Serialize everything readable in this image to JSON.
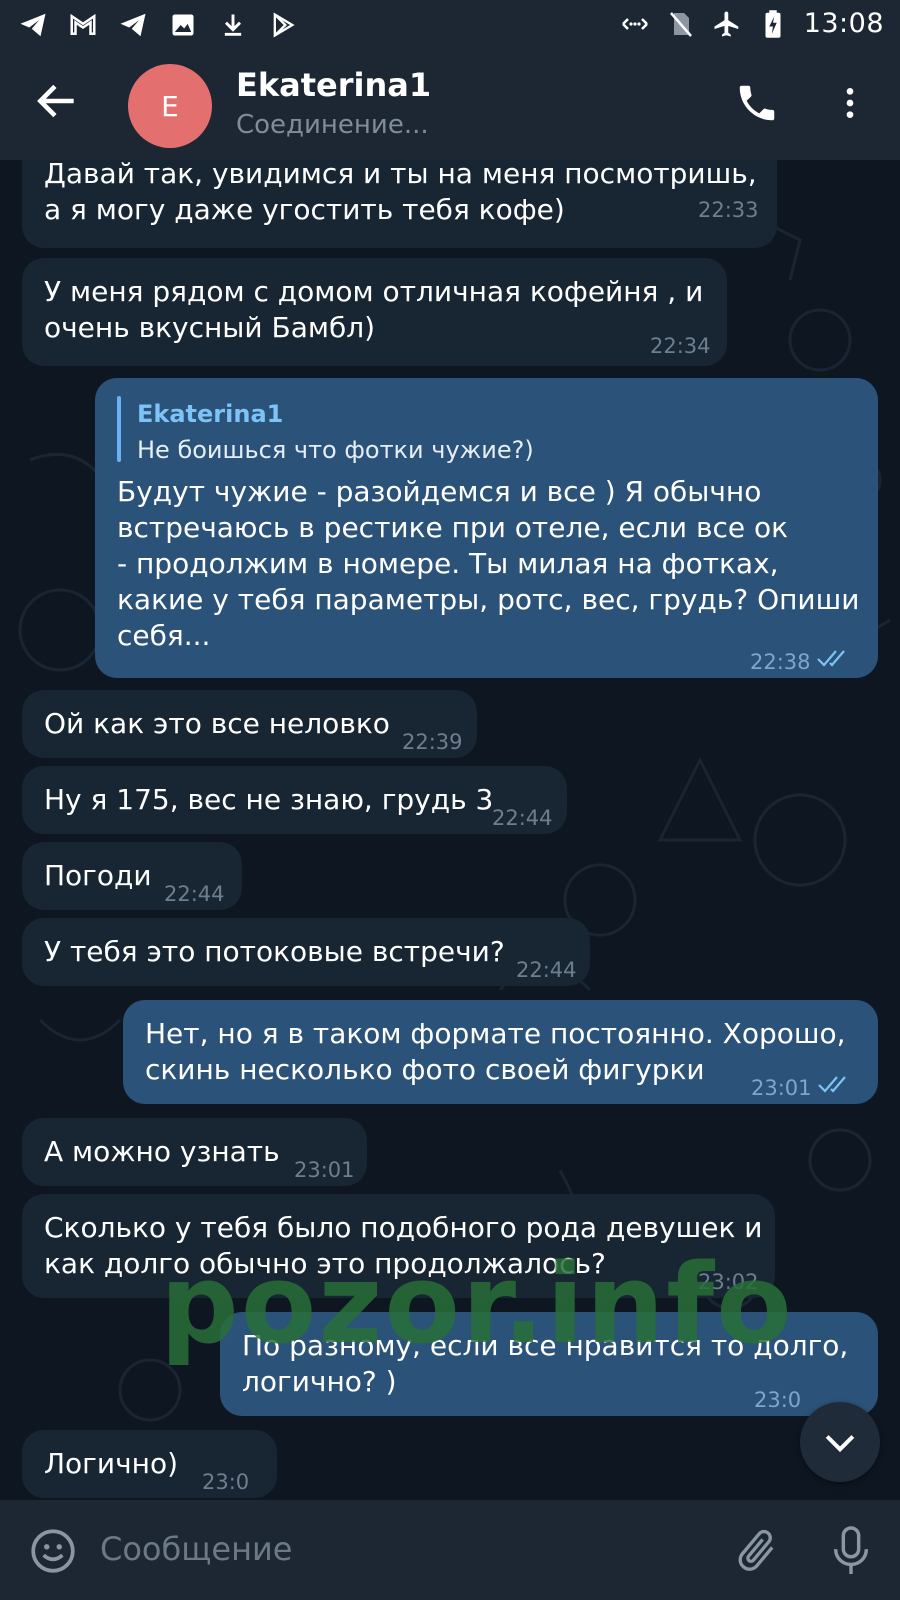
{
  "status_bar": {
    "time": "13:08",
    "left_icons": [
      "telegram-icon",
      "gmail-icon",
      "telegram-icon",
      "image-icon",
      "download-icon",
      "play-store-icon"
    ],
    "right_icons": [
      "data-saver-icon",
      "no-sim-icon",
      "airplane-icon",
      "battery-charging-icon"
    ]
  },
  "header": {
    "avatar_letter": "E",
    "name": "Ekaterina1",
    "status": "Соединение...",
    "avatar_color": "#e46f6f"
  },
  "messages": [
    {
      "dir": "in",
      "text": "Давай так, увидимся и ты на меня посмотришь,\nа я могу даже угостить тебя кофе)",
      "time": "22:33"
    },
    {
      "dir": "in",
      "text": "У меня рядом с домом отличная кофейня , и\nочень вкусный Бамбл)",
      "time": "22:34"
    },
    {
      "dir": "out",
      "reply_name": "Ekaterina1",
      "reply_text": "Не боишься что фотки чужие?)",
      "text": "Будут чужие - разойдемся и все ) Я обычно\nвстречаюсь в рестике при отеле, если все ок\n- продолжим в номере. Ты милая на фотках,\nкакие у тебя параметры, ротс, вес, грудь? Опиши\nсебя...",
      "time": "22:38"
    },
    {
      "dir": "in",
      "text": "Ой как это все неловко",
      "time": "22:39"
    },
    {
      "dir": "in",
      "text": "Ну я 175, вес не знаю, грудь 3",
      "time": "22:44"
    },
    {
      "dir": "in",
      "text": "Погоди",
      "time": "22:44"
    },
    {
      "dir": "in",
      "text": "У тебя это потоковые встречи?",
      "time": "22:44"
    },
    {
      "dir": "out",
      "text": "Нет, но я в таком формате постоянно. Хорошо,\nскинь несколько фото своей фигурки",
      "time": "23:01"
    },
    {
      "dir": "in",
      "text": "А можно узнать",
      "time": "23:01"
    },
    {
      "dir": "in",
      "text": "Сколько у тебя было подобного рода девушек и\nкак долго обычно это продолжалось?",
      "time": "23:02"
    },
    {
      "dir": "out",
      "text": "По разному, если все нравится то долго,\nлогично? )",
      "time": "23:0"
    },
    {
      "dir": "in",
      "text": "Логично)",
      "time": "23:0"
    }
  ],
  "watermark": "pozor.info",
  "input": {
    "placeholder": "Сообщение"
  },
  "colors": {
    "background": "#0e1621",
    "bar": "#1d2733",
    "incoming_bubble": "#182533",
    "outgoing_bubble": "#2b5278",
    "accent": "#6ab3f3"
  }
}
